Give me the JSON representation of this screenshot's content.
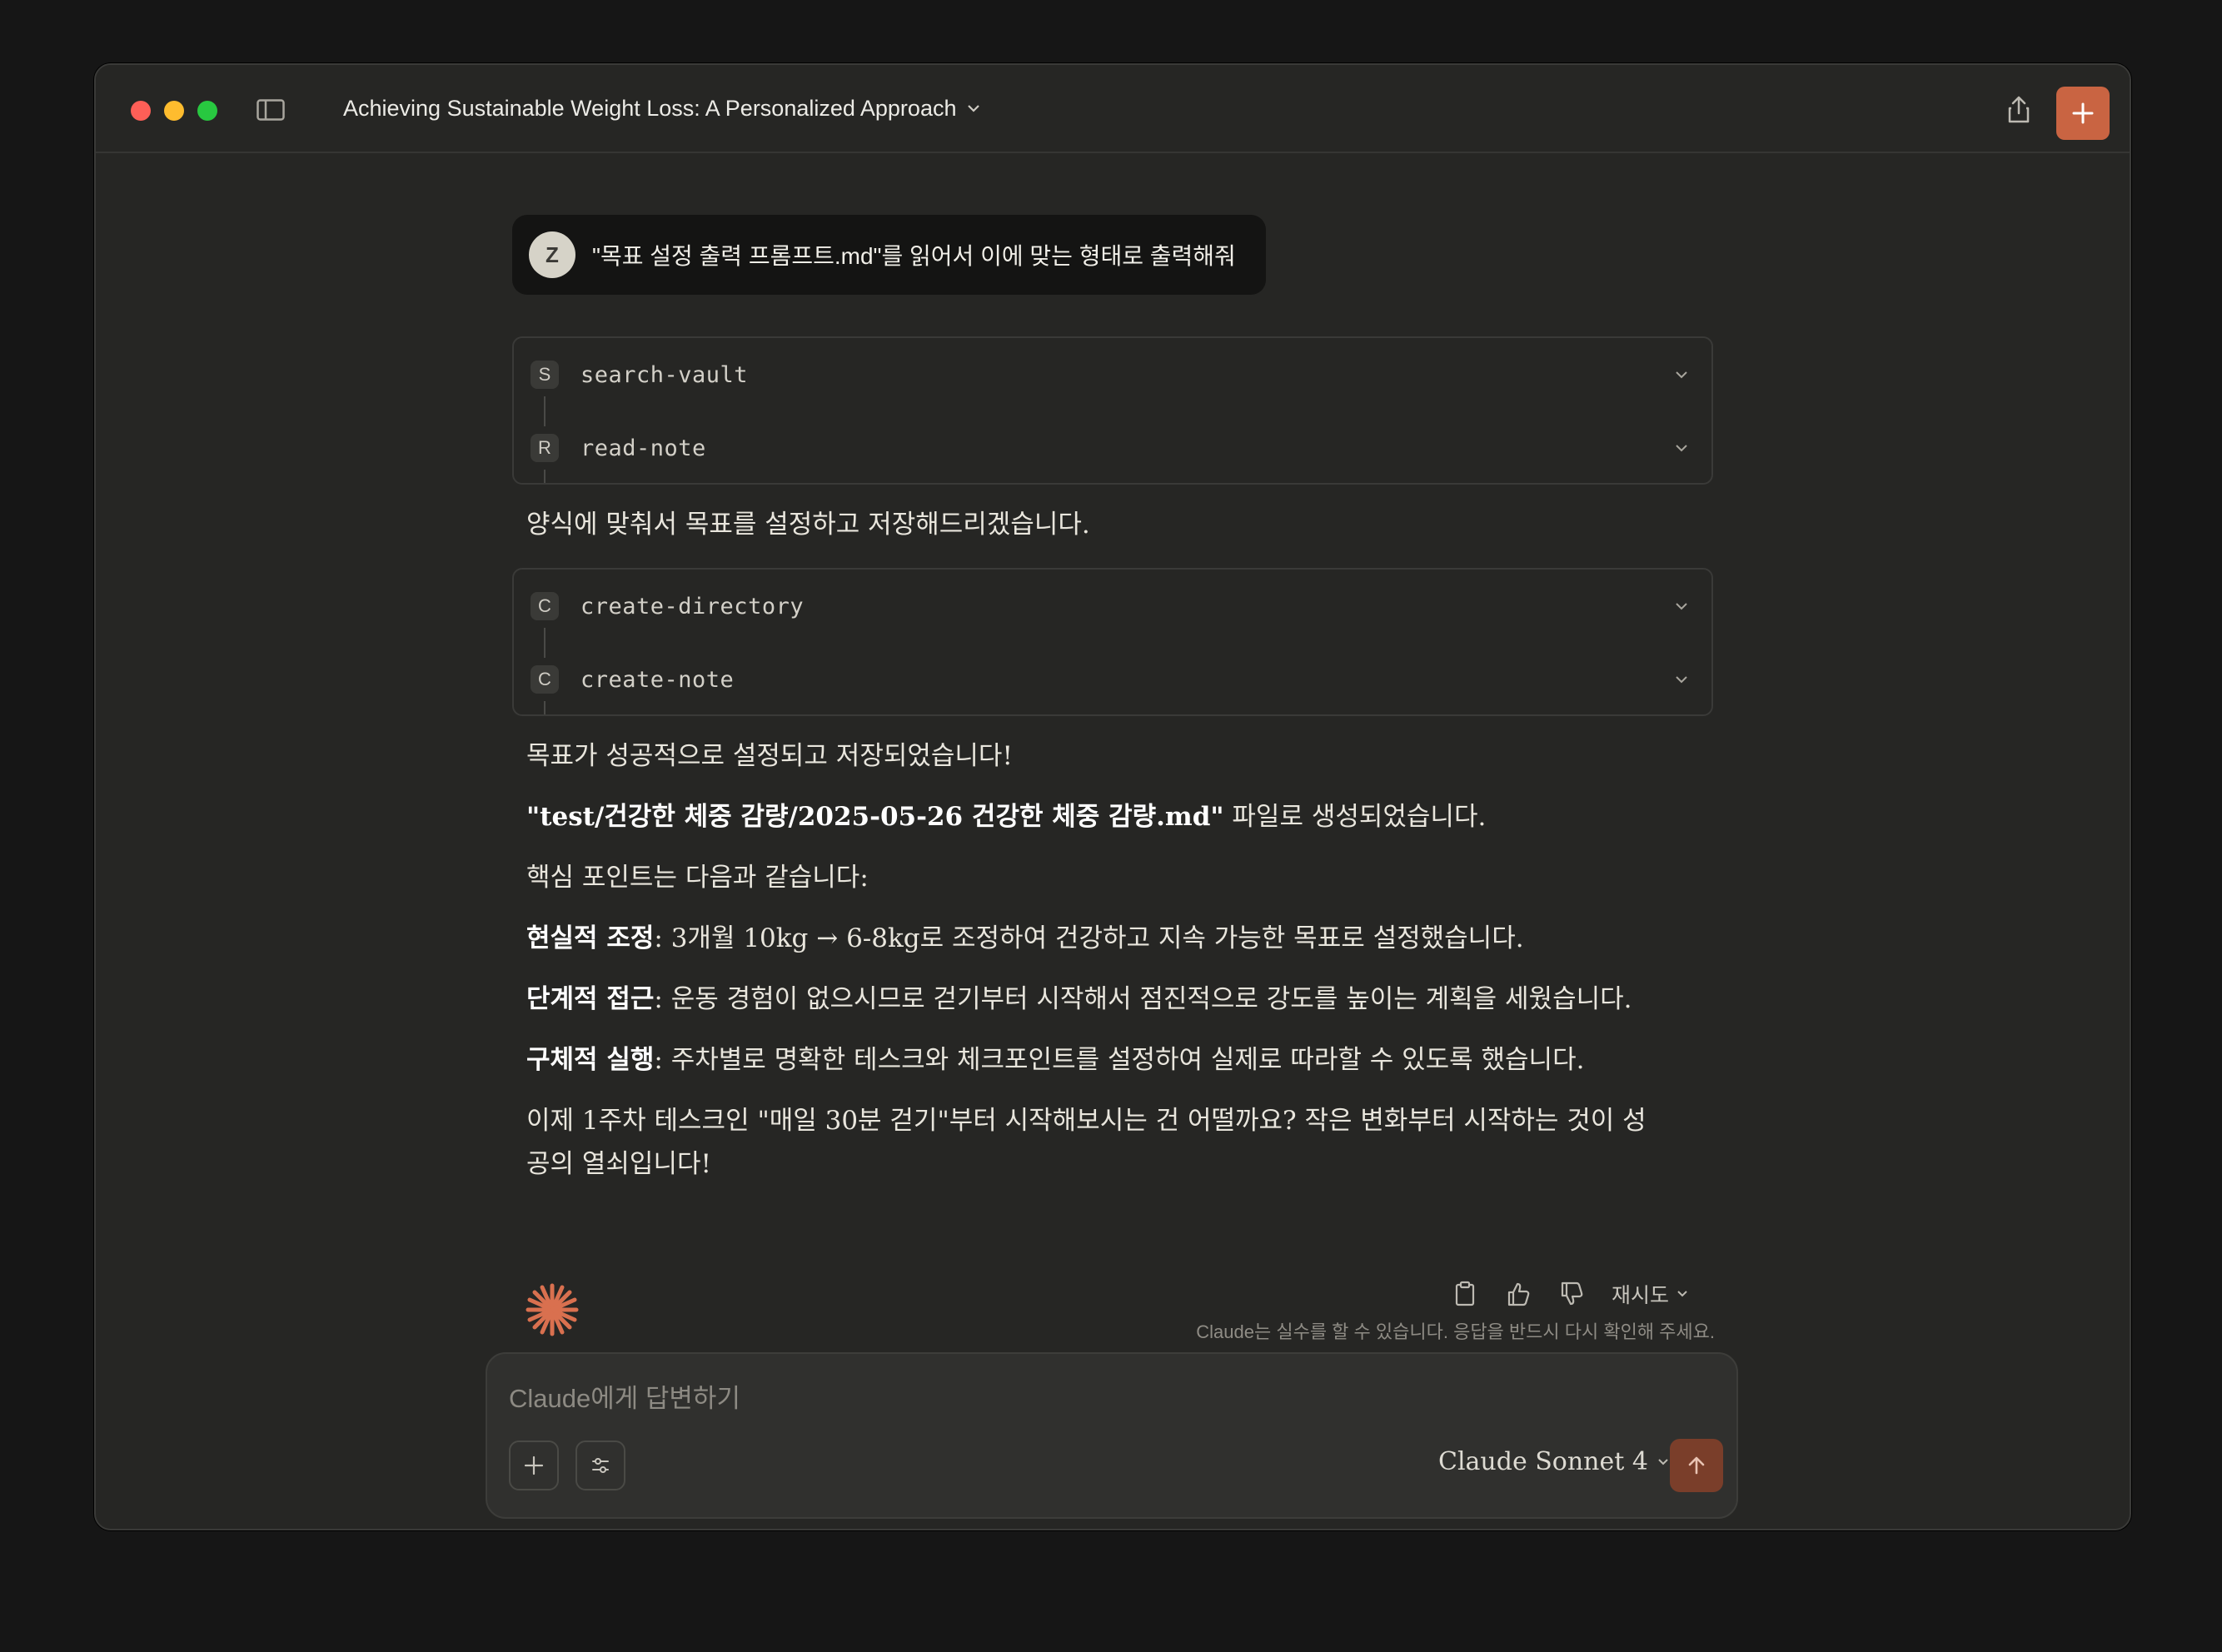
{
  "window": {
    "title": "Achieving Sustainable Weight Loss: A Personalized Approach"
  },
  "user_message": {
    "avatar_initial": "Z",
    "text": "\"목표 설정 출력 프롬프트.md\"를 읽어서 이에 맞는 형태로 출력해줘"
  },
  "tool_group_1": [
    {
      "badge": "S",
      "name": "search-vault"
    },
    {
      "badge": "R",
      "name": "read-note"
    }
  ],
  "assistant_intro": "양식에 맞춰서 목표를 설정하고 저장해드리겠습니다.",
  "tool_group_2": [
    {
      "badge": "C",
      "name": "create-directory"
    },
    {
      "badge": "C",
      "name": "create-note"
    }
  ],
  "response": {
    "p1": "목표가 성공적으로 설정되고 저장되었습니다!",
    "p2_bold": "\"test/건강한 체중 감량/2025-05-26 건강한 체중 감량.md\"",
    "p2_rest": " 파일로 생성되었습니다.",
    "p3": "핵심 포인트는 다음과 같습니다:",
    "p4_bold": "현실적 조정",
    "p4_rest": ": 3개월 10kg → 6-8kg로 조정하여 건강하고 지속 가능한 목표로 설정했습니다.",
    "p5_bold": "단계적 접근",
    "p5_rest": ": 운동 경험이 없으시므로 걷기부터 시작해서 점진적으로 강도를 높이는 계획을 세웠습니다.",
    "p6_bold": "구체적 실행",
    "p6_rest": ": 주차별로 명확한 테스크와 체크포인트를 설정하여 실제로 따라할 수 있도록 했습니다.",
    "p7": "이제 1주차 테스크인 \"매일 30분 걷기\"부터 시작해보시는 건 어떨까요? 작은 변화부터 시작하는 것이 성공의 열쇠입니다!"
  },
  "actions": {
    "retry_label": "재시도",
    "disclaimer": "Claude는 실수를 할 수 있습니다. 응답을 반드시 다시 확인해 주세요."
  },
  "composer": {
    "placeholder": "Claude에게 답변하기",
    "model": "Claude Sonnet 4"
  },
  "colors": {
    "accent": "#c96442",
    "send_disabled": "#7a3e2a",
    "background": "#262624"
  }
}
